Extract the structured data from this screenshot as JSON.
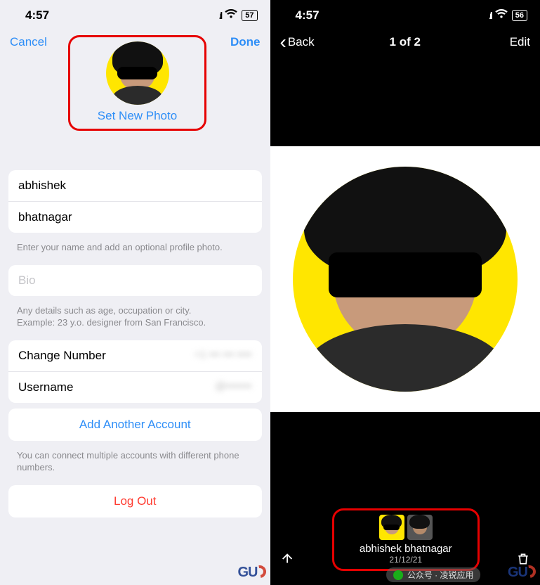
{
  "left": {
    "status": {
      "time": "4:57",
      "battery": "57"
    },
    "nav": {
      "cancel": "Cancel",
      "done": "Done"
    },
    "photo": {
      "setNew": "Set New Photo"
    },
    "name": {
      "first": "abhishek",
      "last": "bhatnagar"
    },
    "nameFooter": "Enter your name and add an optional profile photo.",
    "bio": {
      "placeholder": "Bio"
    },
    "bioFooter": "Any details such as age, occupation or city.\nExample: 23 y.o. designer from San Francisco.",
    "rows": {
      "changeNumber": "Change Number",
      "username": "Username"
    },
    "addAccount": "Add Another Account",
    "addFooter": "You can connect multiple accounts with different phone numbers.",
    "logOut": "Log Out"
  },
  "right": {
    "status": {
      "time": "4:57",
      "battery": "56"
    },
    "nav": {
      "back": "Back",
      "title": "1 of 2",
      "edit": "Edit"
    },
    "user": "abhishek bhatnagar",
    "date": "21/12/21"
  },
  "overlay": {
    "text": "公众号 · 凌锐应用"
  },
  "watermark": "GU"
}
